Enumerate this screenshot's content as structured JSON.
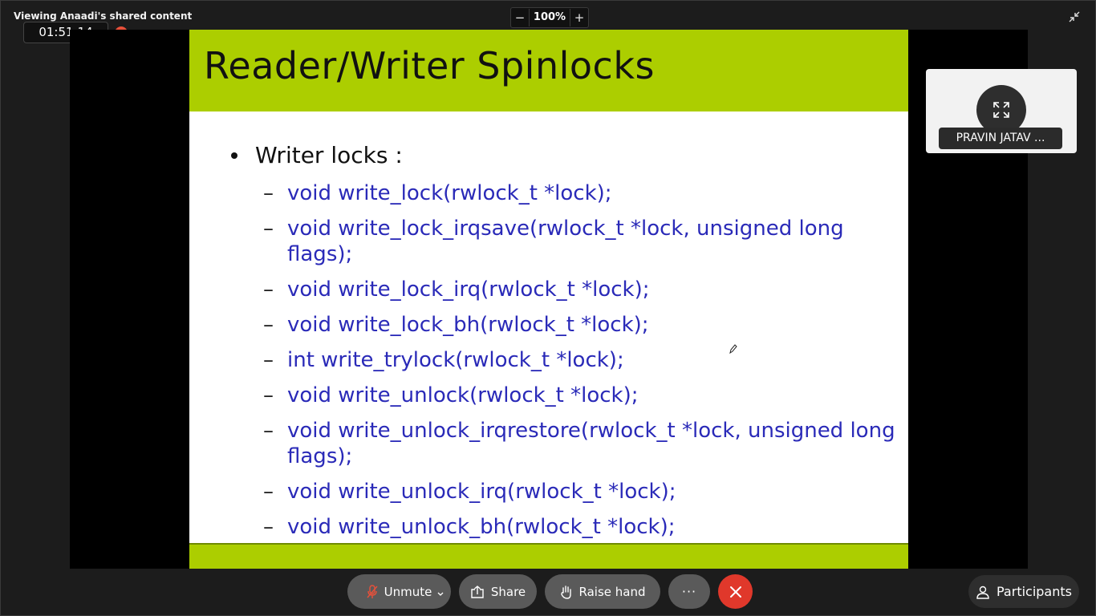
{
  "window": {
    "share_title": "Viewing Anaadi's shared content",
    "timer": "01:51:14"
  },
  "zoom": {
    "minus_label": "−",
    "level": "100%",
    "plus_label": "+"
  },
  "slide": {
    "title": "Reader/Writer Spinlocks",
    "bullet": "Writer locks :",
    "items": [
      "void write_lock(rwlock_t *lock);",
      "void write_lock_irqsave(rwlock_t *lock, unsigned long flags);",
      "void write_lock_irq(rwlock_t *lock);",
      "void write_lock_bh(rwlock_t *lock);",
      "int write_trylock(rwlock_t *lock);",
      "void write_unlock(rwlock_t *lock);",
      "void write_unlock_irqrestore(rwlock_t *lock, unsigned long flags);",
      "void write_unlock_irq(rwlock_t *lock);",
      "void write_unlock_bh(rwlock_t *lock);"
    ],
    "colors": {
      "accent_bar": "#acce00",
      "code_text": "#2a2ab8"
    }
  },
  "participant": {
    "name": "PRAVIN JATAV ..."
  },
  "controls": {
    "unmute": "Unmute",
    "share": "Share",
    "raise_hand": "Raise hand",
    "more": "···",
    "participants": "Participants"
  },
  "colors": {
    "leave_button": "#e0382b",
    "recording_dot": "#e8503a"
  }
}
